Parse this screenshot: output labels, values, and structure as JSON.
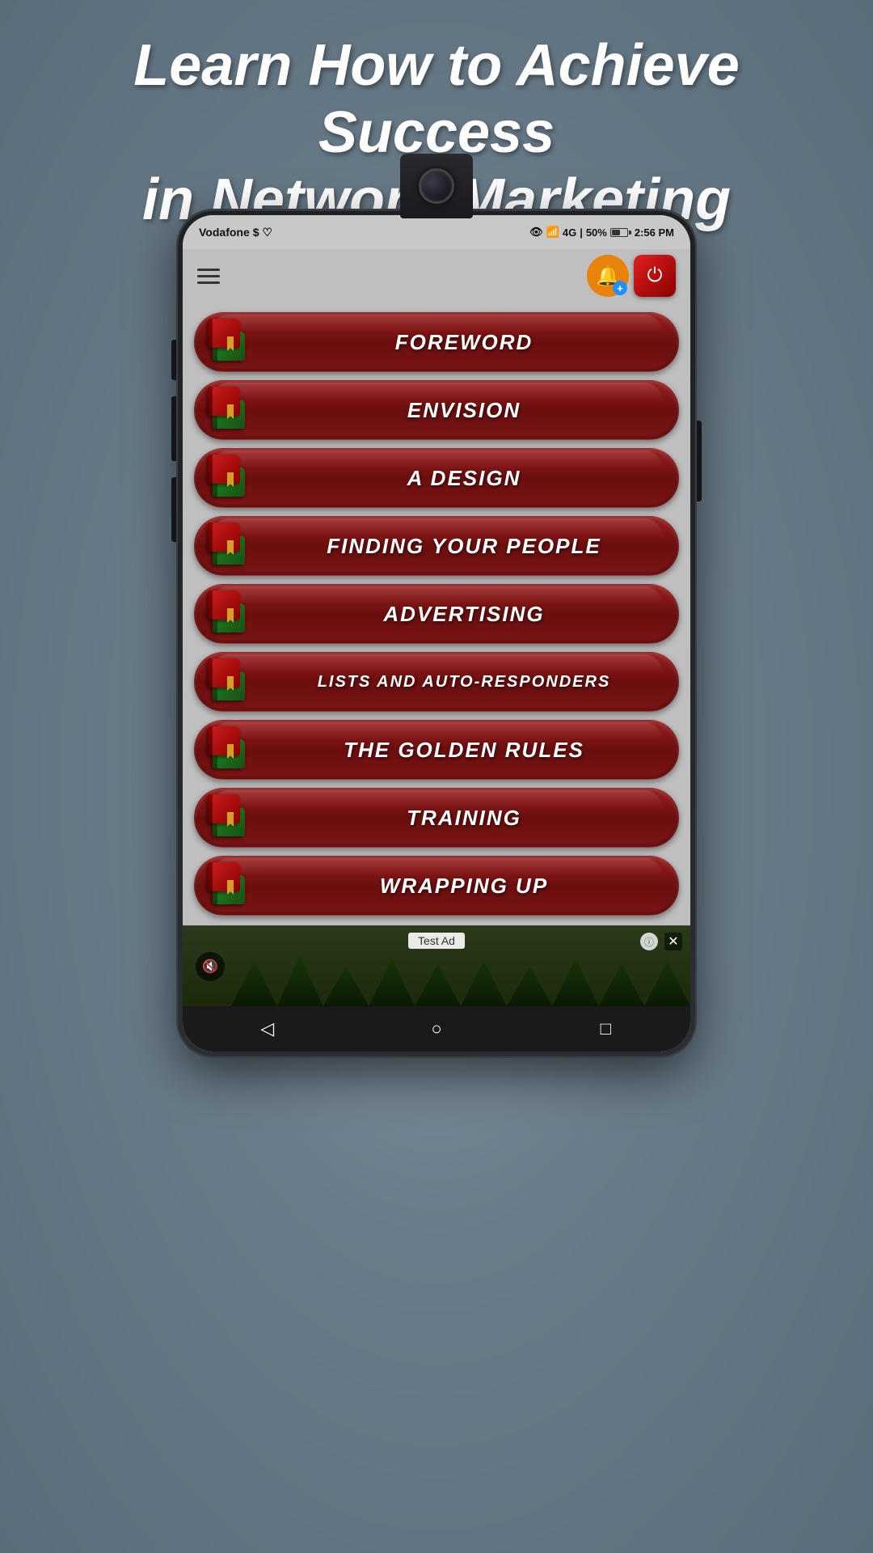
{
  "header": {
    "title_line1": "Learn How to Achieve Success",
    "title_line2": "in Network Marketing"
  },
  "status_bar": {
    "carrier": "Vodafone",
    "time": "2:56 PM",
    "battery": "50%",
    "signal": "4G"
  },
  "app_header": {
    "menu_icon": "≡",
    "bell_plus": "+",
    "power_label": "⏻"
  },
  "menu_items": [
    {
      "id": "foreword",
      "label": "FOREWORD"
    },
    {
      "id": "envision",
      "label": "ENVISION"
    },
    {
      "id": "a-design",
      "label": "A DESIGN"
    },
    {
      "id": "finding-your-people",
      "label": "FINDING YOUR PEOPLE"
    },
    {
      "id": "advertising",
      "label": "ADVERTISING"
    },
    {
      "id": "lists-and-auto-responders",
      "label": "LISTS AND AUTO-RESPONDERS"
    },
    {
      "id": "the-golden-rules",
      "label": "ThE GOLDEN RULES"
    },
    {
      "id": "training",
      "label": "TRAINING"
    },
    {
      "id": "wrapping-up",
      "label": "WRAPPING UP"
    }
  ],
  "ad": {
    "label": "Test Ad",
    "info_symbol": "ⓘ",
    "close_symbol": "✕",
    "mute_symbol": "🔇"
  },
  "nav": {
    "back_symbol": "◁",
    "home_symbol": "○",
    "recent_symbol": "□"
  },
  "colors": {
    "button_bg_start": "#9b2020",
    "button_bg_end": "#6b0e0e",
    "accent_orange": "#e8820a",
    "accent_blue": "#1e90ff",
    "accent_red": "#e02020",
    "dark_red": "#8b0000"
  }
}
